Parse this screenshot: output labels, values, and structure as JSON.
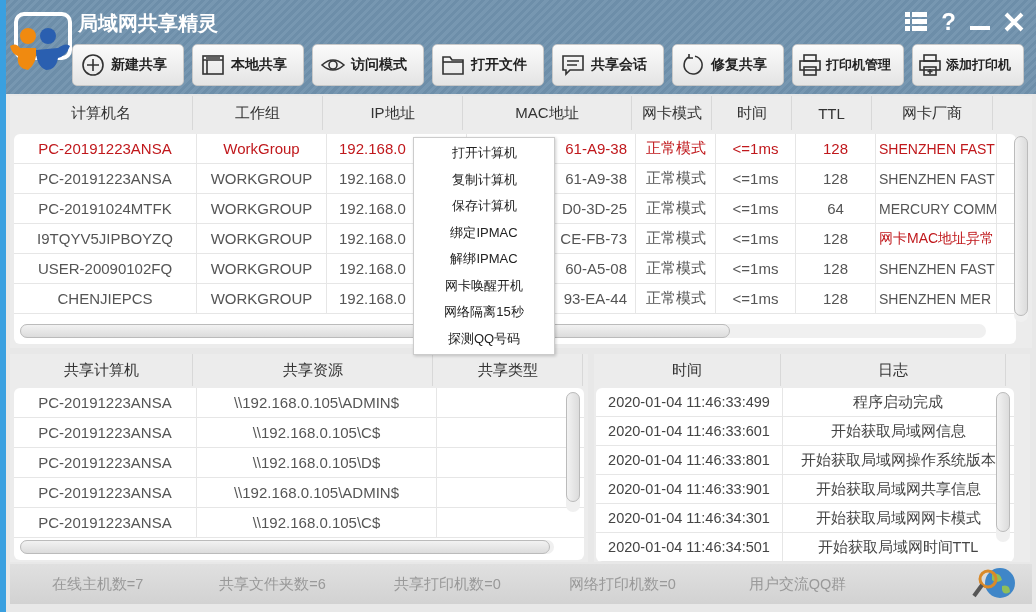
{
  "window": {
    "title": "局域网共享精灵",
    "help": "?"
  },
  "toolbar": [
    {
      "label": "新建共享"
    },
    {
      "label": "本地共享"
    },
    {
      "label": "访问模式"
    },
    {
      "label": "打开文件"
    },
    {
      "label": "共享会话"
    },
    {
      "label": "修复共享"
    },
    {
      "label": "打印机管理"
    },
    {
      "label": "添加打印机"
    }
  ],
  "hosts": {
    "columns": [
      "计算机名",
      "工作组",
      "IP地址",
      "MAC地址",
      "网卡模式",
      "时间",
      "TTL",
      "网卡厂商"
    ],
    "rows": [
      {
        "highlighted": true,
        "vendor_warning": false,
        "cells": [
          "PC-20191223ANSA",
          "WorkGroup",
          "192.168.0",
          "61-A9-38",
          "正常模式",
          "<=1ms",
          "128",
          "SHENZHEN FAST"
        ]
      },
      {
        "highlighted": false,
        "vendor_warning": false,
        "cells": [
          "PC-20191223ANSA",
          "WORKGROUP",
          "192.168.0",
          "61-A9-38",
          "正常模式",
          "<=1ms",
          "128",
          "SHENZHEN FAST"
        ]
      },
      {
        "highlighted": false,
        "vendor_warning": false,
        "cells": [
          "PC-20191024MTFK",
          "WORKGROUP",
          "192.168.0",
          "D0-3D-25",
          "正常模式",
          "<=1ms",
          "64",
          "MERCURY COMM"
        ]
      },
      {
        "highlighted": false,
        "vendor_warning": true,
        "cells": [
          "I9TQYV5JIPBOYZQ",
          "WORKGROUP",
          "192.168.0",
          "CE-FB-73",
          "正常模式",
          "<=1ms",
          "128",
          "网卡MAC地址异常"
        ]
      },
      {
        "highlighted": false,
        "vendor_warning": false,
        "cells": [
          "USER-20090102FQ",
          "WORKGROUP",
          "192.168.0",
          "60-A5-08",
          "正常模式",
          "<=1ms",
          "128",
          "SHENZHEN FAST"
        ]
      },
      {
        "highlighted": false,
        "vendor_warning": false,
        "cells": [
          "CHENJIEPCS",
          "WORKGROUP",
          "192.168.0",
          "93-EA-44",
          "正常模式",
          "<=1ms",
          "128",
          "SHENZHEN MER"
        ]
      }
    ]
  },
  "context_menu": [
    "打开计算机",
    "复制计算机",
    "保存计算机",
    "绑定IPMAC",
    "解绑IPMAC",
    "网卡唤醒开机",
    "网络隔离15秒",
    "探测QQ号码"
  ],
  "shares": {
    "columns": [
      "共享计算机",
      "共享资源",
      "共享类型"
    ],
    "rows": [
      [
        "PC-20191223ANSA",
        "\\\\192.168.0.105\\ADMIN$"
      ],
      [
        "PC-20191223ANSA",
        "\\\\192.168.0.105\\C$"
      ],
      [
        "PC-20191223ANSA",
        "\\\\192.168.0.105\\D$"
      ],
      [
        "PC-20191223ANSA",
        "\\\\192.168.0.105\\ADMIN$"
      ],
      [
        "PC-20191223ANSA",
        "\\\\192.168.0.105\\C$"
      ]
    ]
  },
  "log": {
    "columns": [
      "时间",
      "日志"
    ],
    "rows": [
      [
        "2020-01-04 11:46:33:499",
        "程序启动完成"
      ],
      [
        "2020-01-04 11:46:33:601",
        "开始获取局域网信息"
      ],
      [
        "2020-01-04 11:46:33:801",
        "开始获取局域网操作系统版本"
      ],
      [
        "2020-01-04 11:46:33:901",
        "开始获取局域网共享信息"
      ],
      [
        "2020-01-04 11:46:34:301",
        "开始获取局域网网卡模式"
      ],
      [
        "2020-01-04 11:46:34:501",
        "开始获取局域网时间TTL"
      ]
    ]
  },
  "status_bar": [
    "在线主机数=7",
    "共享文件夹数=6",
    "共享打印机数=0",
    "网络打印机数=0",
    "用户交流QQ群"
  ]
}
